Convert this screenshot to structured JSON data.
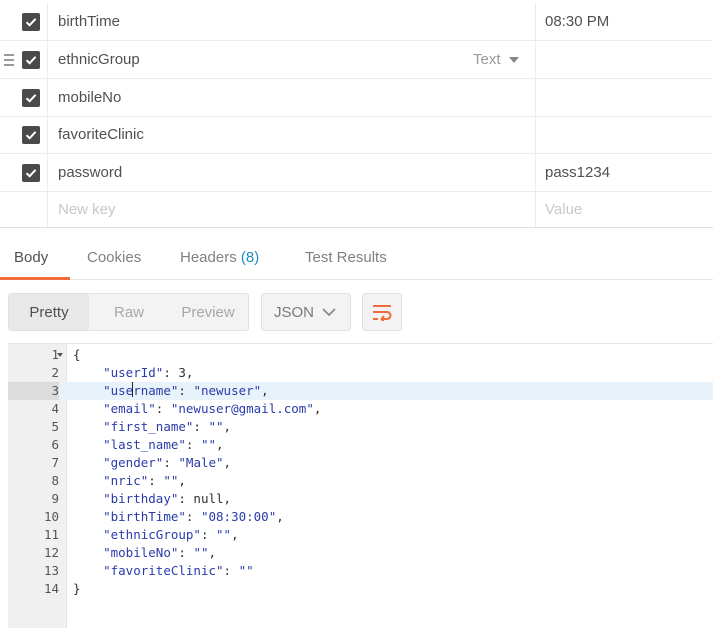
{
  "params": {
    "rows": [
      {
        "key": "birthTime",
        "value": "08:30 PM",
        "checked": true
      },
      {
        "key": "ethnicGroup",
        "value": "",
        "type": "Text",
        "checked": true
      },
      {
        "key": "mobileNo",
        "value": "",
        "checked": true
      },
      {
        "key": "favoriteClinic",
        "value": "",
        "checked": true
      },
      {
        "key": "password",
        "value": "pass1234",
        "checked": true
      }
    ],
    "new_key_placeholder": "New key",
    "new_value_placeholder": "Value"
  },
  "tabs": {
    "body": "Body",
    "cookies": "Cookies",
    "headers": "Headers",
    "headers_count": "(8)",
    "test_results": "Test Results"
  },
  "toolbar": {
    "pretty": "Pretty",
    "raw": "Raw",
    "preview": "Preview",
    "format": "JSON",
    "accent_color": "#f26b3a"
  },
  "editor": {
    "highlighted_line": 3,
    "lines": [
      "{",
      "    \"userId\": 3,",
      "    \"username\": \"newuser\",",
      "    \"email\": \"newuser@gmail.com\",",
      "    \"first_name\": \"\",",
      "    \"last_name\": \"\",",
      "    \"gender\": \"Male\",",
      "    \"nric\": \"\",",
      "    \"birthday\": null,",
      "    \"birthTime\": \"08:30:00\",",
      "    \"ethnicGroup\": \"\",",
      "    \"mobileNo\": \"\",",
      "    \"favoriteClinic\": \"\"",
      "}"
    ]
  }
}
